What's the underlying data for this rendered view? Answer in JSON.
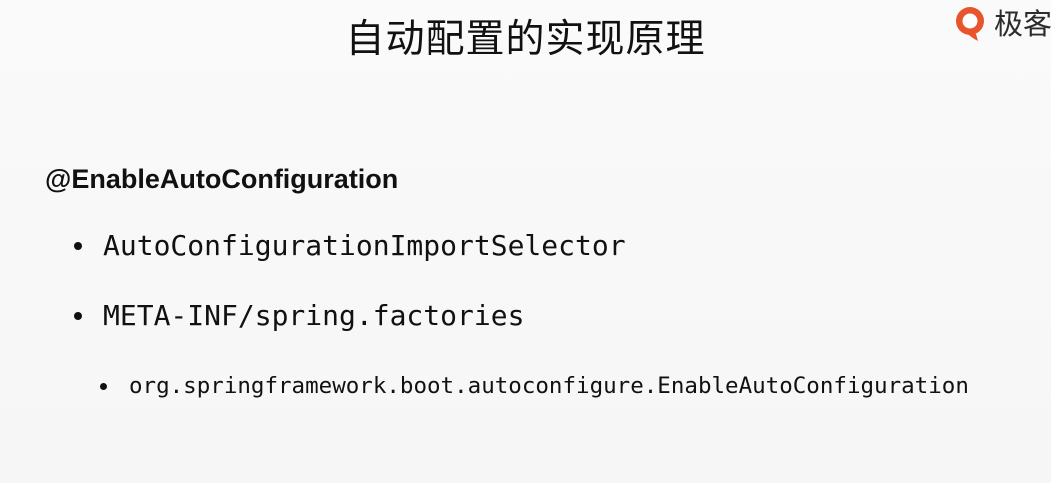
{
  "slide": {
    "title": "自动配置的实现原理",
    "logo_text": "极客",
    "heading": "@EnableAutoConfiguration",
    "bullets": [
      {
        "text": "AutoConfigurationImportSelector"
      },
      {
        "text": "META-INF/spring.factories"
      }
    ],
    "sub_bullets": [
      {
        "text": "org.springframework.boot.autoconfigure.EnableAutoConfiguration"
      }
    ]
  },
  "colors": {
    "background": "#f8f8f8",
    "text": "#111111",
    "logo_accent": "#e8552c"
  },
  "icons": {
    "logo": "geektime-logo-icon"
  }
}
